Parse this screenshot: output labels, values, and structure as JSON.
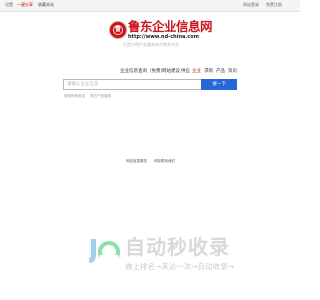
{
  "topbar": {
    "left_1": "设置",
    "left_2": "一键分享",
    "left_3": "收藏本站",
    "right_1": "网站登录",
    "right_2": "免费注册"
  },
  "logo": {
    "emblem_text": "鲁",
    "title": "鲁东企业信息网",
    "url": "http://www.nd-china.com",
    "slogan": "打造宁德产业服务电子商务平台"
  },
  "tabs": [
    "企业信息查询（免费）",
    "网站建设",
    "供应",
    "企业",
    "求购",
    "产品",
    "资讯"
  ],
  "active_tab_index": 3,
  "search": {
    "placeholder": "请输入企业信息",
    "button_label": "搜一下"
  },
  "hints": {
    "left": "搜索所有信息",
    "right": "其它产品搜索"
  },
  "footer": {
    "left": "网站信息服务",
    "right": "网站联系我们"
  },
  "watermark": {
    "title": "自动秒收录",
    "subtitle": "做上排名→来访一次→自动收录→"
  },
  "colors": {
    "brand_red": "#c8161d",
    "button_blue": "#2468d8"
  }
}
